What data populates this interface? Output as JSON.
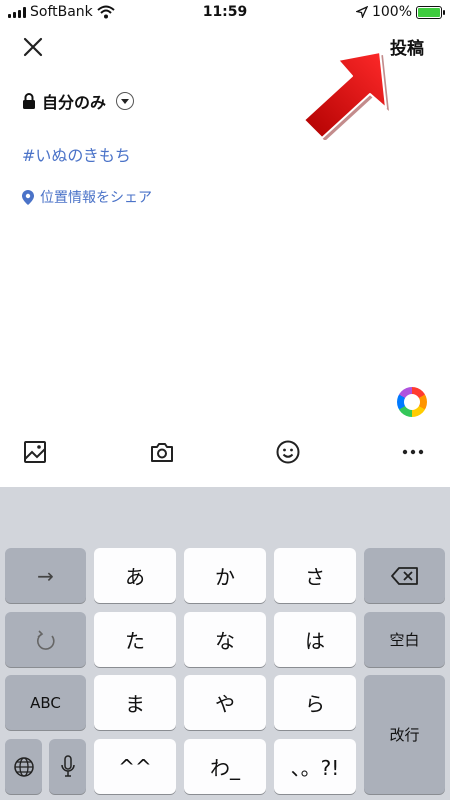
{
  "status_bar": {
    "carrier": "SoftBank",
    "time": "11:59",
    "battery": "100%"
  },
  "header": {
    "post_label": "投稿"
  },
  "privacy": {
    "label": "自分のみ"
  },
  "composer": {
    "hashtag": "#いぬのきもち",
    "location_label": "位置情報をシェア"
  },
  "toolbar": {
    "icons": [
      "image-icon",
      "camera-icon",
      "emoji-icon",
      "more-icon"
    ]
  },
  "keyboard": {
    "row1": [
      "→",
      "あ",
      "か",
      "さ"
    ],
    "row2": [
      "た",
      "な",
      "は",
      "空白"
    ],
    "row3": [
      "ABC",
      "ま",
      "や",
      "ら",
      "改行"
    ],
    "row4": [
      "^^",
      "わ_",
      "、。?!"
    ]
  },
  "colors": {
    "accent_blue": "#4b73c8",
    "arrow_red": "#e00000",
    "keyboard_bg": "#d2d5db"
  }
}
